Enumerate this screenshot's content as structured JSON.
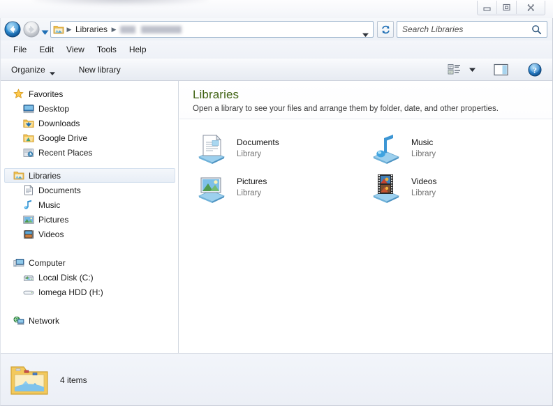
{
  "window": {
    "title": "",
    "controls": {
      "minimize": "Minimize",
      "maximize": "Maximize",
      "close": "Close"
    }
  },
  "navbar": {
    "back_label": "Back",
    "forward_label": "Forward",
    "history_label": "Recent pages",
    "breadcrumb": [
      {
        "label": "Libraries",
        "redacted": false
      },
      {
        "label": "",
        "redacted": true
      }
    ],
    "address_dropdown_label": "Previous locations",
    "refresh_label": "Refresh",
    "search": {
      "value": "",
      "placeholder": "Search Libraries"
    }
  },
  "menubar": {
    "items": [
      {
        "label": "File"
      },
      {
        "label": "Edit"
      },
      {
        "label": "View"
      },
      {
        "label": "Tools"
      },
      {
        "label": "Help"
      }
    ]
  },
  "toolbar": {
    "organize_label": "Organize",
    "new_library_label": "New library",
    "view_options_label": "Change your view",
    "preview_pane_label": "Show the preview pane",
    "help_label": "Get help"
  },
  "sidebar": {
    "groups": [
      {
        "name": "favorites",
        "header": {
          "label": "Favorites",
          "icon": "star-icon"
        },
        "items": [
          {
            "label": "Desktop",
            "icon": "desktop-icon"
          },
          {
            "label": "Downloads",
            "icon": "downloads-folder-icon"
          },
          {
            "label": "Google Drive",
            "icon": "google-drive-folder-icon"
          },
          {
            "label": "Recent Places",
            "icon": "recent-places-icon"
          }
        ]
      },
      {
        "name": "libraries",
        "header": {
          "label": "Libraries",
          "icon": "libraries-folder-icon",
          "selected": true
        },
        "items": [
          {
            "label": "Documents",
            "icon": "documents-library-icon"
          },
          {
            "label": "Music",
            "icon": "music-library-icon"
          },
          {
            "label": "Pictures",
            "icon": "pictures-library-icon"
          },
          {
            "label": "Videos",
            "icon": "videos-library-icon"
          }
        ]
      },
      {
        "name": "computer",
        "header": {
          "label": "Computer",
          "icon": "computer-icon"
        },
        "items": [
          {
            "label": "Local Disk (C:)",
            "icon": "hard-drive-system-icon"
          },
          {
            "label": "Iomega HDD (H:)",
            "icon": "external-drive-icon"
          }
        ]
      },
      {
        "name": "network",
        "header": {
          "label": "Network",
          "icon": "network-icon"
        },
        "items": []
      }
    ]
  },
  "content": {
    "title": "Libraries",
    "subtitle": "Open a library to see your files and arrange them by folder, date, and other properties.",
    "tiles": [
      {
        "name": "Documents",
        "kind": "Library",
        "icon": "documents-library-icon"
      },
      {
        "name": "Music",
        "kind": "Library",
        "icon": "music-library-icon"
      },
      {
        "name": "Pictures",
        "kind": "Library",
        "icon": "pictures-library-icon"
      },
      {
        "name": "Videos",
        "kind": "Library",
        "icon": "videos-library-icon"
      }
    ]
  },
  "statusbar": {
    "icon": "libraries-folder-icon",
    "item_count_text": "4 items"
  },
  "colors": {
    "title_green": "#3f6212",
    "accent_blue": "#1f6fb5",
    "selection_bg": "#e8eef6",
    "chrome_bg": "#eef1f7"
  }
}
